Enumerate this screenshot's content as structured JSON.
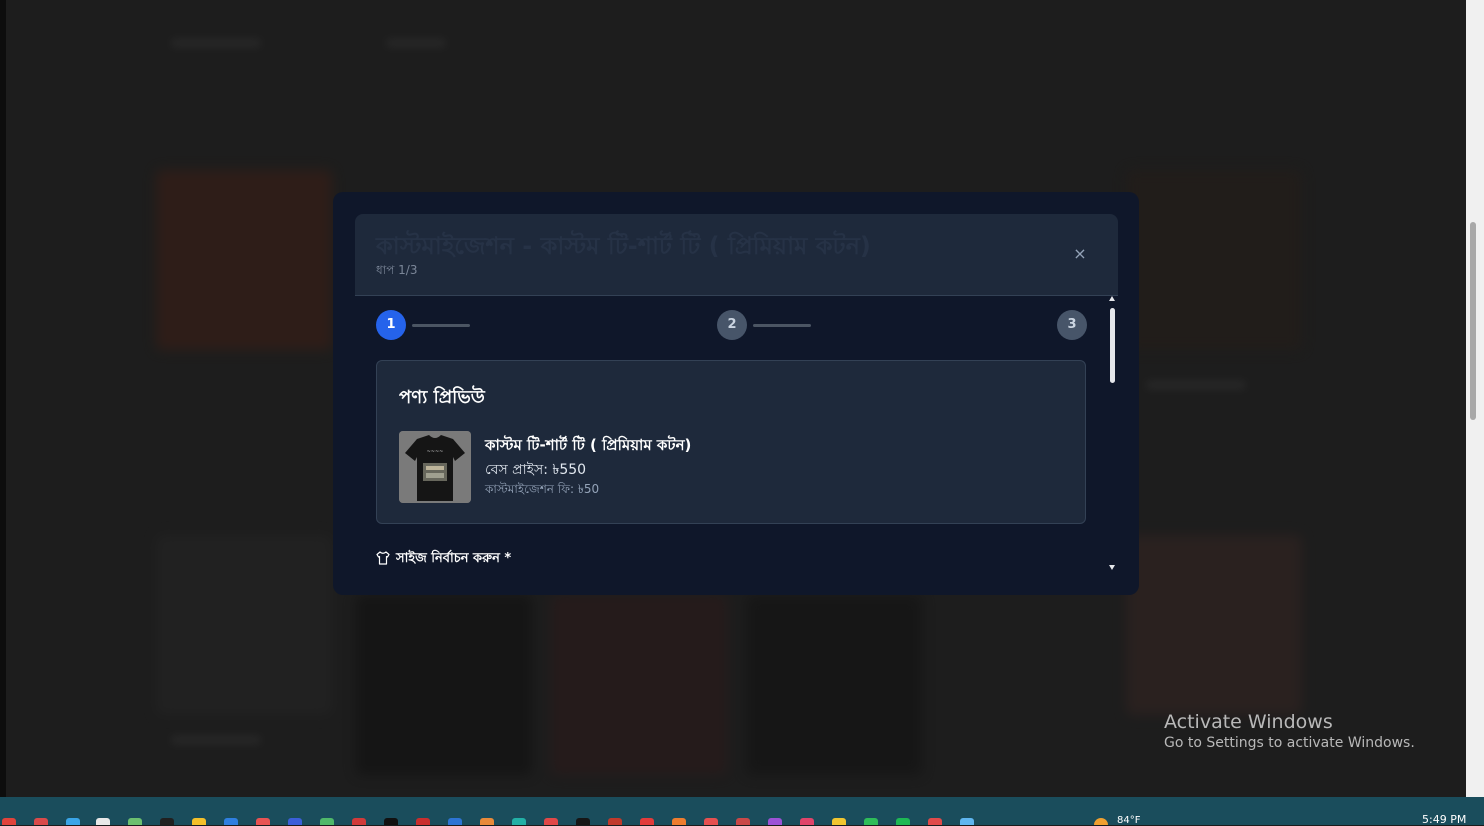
{
  "modal": {
    "title": "কাস্টমাইজেশন - কাস্টম টি-শার্ট টি ( প্রিমিয়াম কটন)",
    "step_indicator": "ধাপ 1/3",
    "close_icon": "×",
    "steps": [
      {
        "number": "1",
        "state": "active"
      },
      {
        "number": "2",
        "state": "pending"
      },
      {
        "number": "3",
        "state": "pending"
      }
    ],
    "preview": {
      "heading": "পণ্য প্রিভিউ",
      "product_name": "কাস্টম টি-শার্ট টি ( প্রিমিয়াম কটন)",
      "base_price": "বেস প্রাইস: ৳550",
      "customization_fee": "কাস্টমাইজেশন ফি: ৳50"
    },
    "size_section": {
      "icon": "tshirt-icon",
      "label": "সাইজ নির্বাচন করুন *"
    }
  },
  "windows_watermark": {
    "title": "Activate Windows",
    "subtitle": "Go to Settings to activate Windows."
  },
  "taskbar": {
    "weather": "84°F",
    "clock": "5:49 PM"
  },
  "colors": {
    "modal_bg": "#0f172a",
    "card_bg": "#1e293b",
    "accent": "#2563eb",
    "taskbar": "#1a4d5c"
  }
}
